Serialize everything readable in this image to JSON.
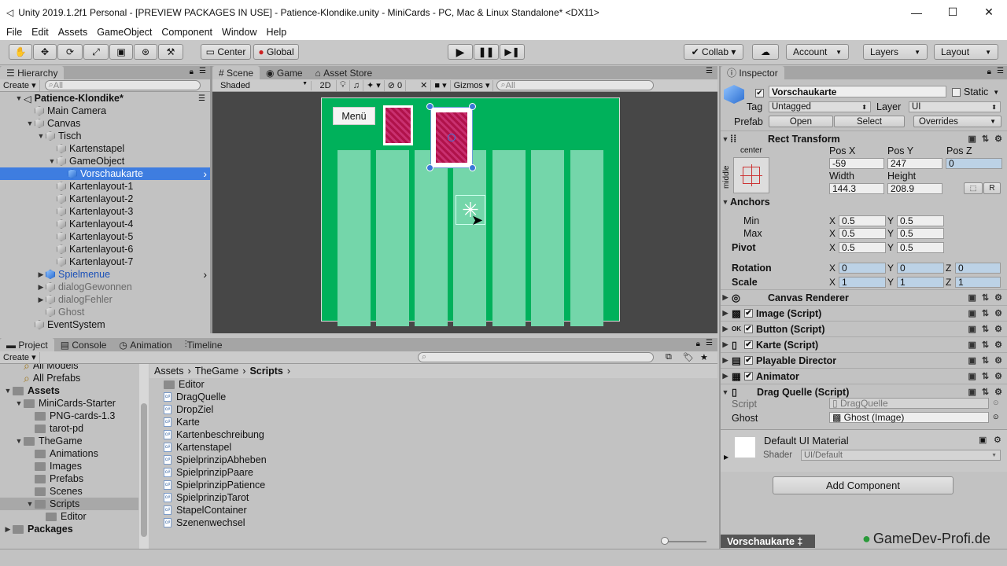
{
  "window": {
    "title": "Unity 2019.1.2f1 Personal - [PREVIEW PACKAGES IN USE] - Patience-Klondike.unity - MiniCards - PC, Mac & Linux Standalone* <DX11>"
  },
  "menu": [
    "File",
    "Edit",
    "Assets",
    "GameObject",
    "Component",
    "Window",
    "Help"
  ],
  "toolbar": {
    "center": "Center",
    "global": "Global",
    "collab": "Collab ▾",
    "account": "Account",
    "layers": "Layers",
    "layout": "Layout"
  },
  "hierarchy": {
    "tab": "Hierarchy",
    "create": "Create ▾",
    "search": "All",
    "items": [
      {
        "label": "Patience-Klondike*",
        "depth": 0,
        "arrow": "▼",
        "icon": "unity-scene-icon"
      },
      {
        "label": "Main Camera",
        "depth": 1,
        "arrow": "",
        "icon": "cube"
      },
      {
        "label": "Canvas",
        "depth": 1,
        "arrow": "▼",
        "icon": "cube"
      },
      {
        "label": "Tisch",
        "depth": 2,
        "arrow": "▼",
        "icon": "cube"
      },
      {
        "label": "Kartenstapel",
        "depth": 3,
        "arrow": "",
        "icon": "cube"
      },
      {
        "label": "GameObject",
        "depth": 3,
        "arrow": "▼",
        "icon": "cube"
      },
      {
        "label": "Vorschaukarte",
        "depth": 4,
        "arrow": "",
        "icon": "cube-blue",
        "selected": true
      },
      {
        "label": "Kartenlayout-1",
        "depth": 3,
        "arrow": "",
        "icon": "cube"
      },
      {
        "label": "Kartenlayout-2",
        "depth": 3,
        "arrow": "",
        "icon": "cube"
      },
      {
        "label": "Kartenlayout-3",
        "depth": 3,
        "arrow": "",
        "icon": "cube"
      },
      {
        "label": "Kartenlayout-4",
        "depth": 3,
        "arrow": "",
        "icon": "cube"
      },
      {
        "label": "Kartenlayout-5",
        "depth": 3,
        "arrow": "",
        "icon": "cube"
      },
      {
        "label": "Kartenlayout-6",
        "depth": 3,
        "arrow": "",
        "icon": "cube"
      },
      {
        "label": "Kartenlayout-7",
        "depth": 3,
        "arrow": "",
        "icon": "cube"
      },
      {
        "label": "Spielmenue",
        "depth": 2,
        "arrow": "▶",
        "icon": "cube-blue",
        "prefab": true
      },
      {
        "label": "dialogGewonnen",
        "depth": 2,
        "arrow": "▶",
        "icon": "cube",
        "dim": true
      },
      {
        "label": "dialogFehler",
        "depth": 2,
        "arrow": "▶",
        "icon": "cube",
        "dim": true
      },
      {
        "label": "Ghost",
        "depth": 2,
        "arrow": "",
        "icon": "cube",
        "dim": true
      },
      {
        "label": "EventSystem",
        "depth": 1,
        "arrow": "",
        "icon": "cube"
      }
    ]
  },
  "scene": {
    "tabs": [
      "Scene",
      "Game",
      "Asset Store"
    ],
    "shaded": "Shaded",
    "twod": "2D",
    "fx_count": "0",
    "gizmos": "Gizmos ▾",
    "search": "All",
    "menu_button": "Menü"
  },
  "project": {
    "tabs": [
      "Project",
      "Console",
      "Animation",
      "Timeline"
    ],
    "create": "Create ▾",
    "tree": [
      {
        "label": "All Models",
        "depth": 1,
        "icon": "search"
      },
      {
        "label": "All Prefabs",
        "depth": 1,
        "icon": "search"
      },
      {
        "label": "Assets",
        "depth": 0,
        "arrow": "▼",
        "bold": true
      },
      {
        "label": "MiniCards-Starter",
        "depth": 1,
        "arrow": "▼"
      },
      {
        "label": "PNG-cards-1.3",
        "depth": 2,
        "arrow": ""
      },
      {
        "label": "tarot-pd",
        "depth": 2,
        "arrow": ""
      },
      {
        "label": "TheGame",
        "depth": 1,
        "arrow": "▼"
      },
      {
        "label": "Animations",
        "depth": 2,
        "arrow": ""
      },
      {
        "label": "Images",
        "depth": 2,
        "arrow": ""
      },
      {
        "label": "Prefabs",
        "depth": 2,
        "arrow": ""
      },
      {
        "label": "Scenes",
        "depth": 2,
        "arrow": ""
      },
      {
        "label": "Scripts",
        "depth": 2,
        "arrow": "▼",
        "selected": true
      },
      {
        "label": "Editor",
        "depth": 3,
        "arrow": ""
      },
      {
        "label": "Packages",
        "depth": 0,
        "arrow": "▶",
        "bold": true
      }
    ],
    "breadcrumb": [
      "Assets",
      "TheGame",
      "Scripts"
    ],
    "files": [
      {
        "label": "Editor",
        "type": "folder"
      },
      {
        "label": "DragQuelle",
        "type": "script"
      },
      {
        "label": "DropZiel",
        "type": "script"
      },
      {
        "label": "Karte",
        "type": "script"
      },
      {
        "label": "Kartenbeschreibung",
        "type": "script"
      },
      {
        "label": "Kartenstapel",
        "type": "script"
      },
      {
        "label": "SpielprinzipAbheben",
        "type": "script"
      },
      {
        "label": "SpielprinzipPaare",
        "type": "script"
      },
      {
        "label": "SpielprinzipPatience",
        "type": "script"
      },
      {
        "label": "SpielprinzipTarot",
        "type": "script"
      },
      {
        "label": "StapelContainer",
        "type": "script"
      },
      {
        "label": "Szenenwechsel",
        "type": "script"
      }
    ]
  },
  "inspector": {
    "tab": "Inspector",
    "name": "Vorschaukarte",
    "static": "Static",
    "tag_label": "Tag",
    "tag": "Untagged",
    "layer_label": "Layer",
    "layer": "UI",
    "prefab_label": "Prefab",
    "open": "Open",
    "select": "Select",
    "overrides": "Overrides",
    "rect": {
      "title": "Rect Transform",
      "anchor_h": "center",
      "anchor_v": "middle",
      "posx_label": "Pos X",
      "posy_label": "Pos Y",
      "posz_label": "Pos Z",
      "posx": "-59",
      "posy": "247",
      "posz": "0",
      "width_label": "Width",
      "height_label": "Height",
      "width": "144.3",
      "height": "208.9",
      "anchors": "Anchors",
      "min": "Min",
      "max": "Max",
      "min_x": "0.5",
      "min_y": "0.5",
      "max_x": "0.5",
      "max_y": "0.5",
      "pivot": "Pivot",
      "pivot_x": "0.5",
      "pivot_y": "0.5",
      "rotation": "Rotation",
      "rot_x": "0",
      "rot_y": "0",
      "rot_z": "0",
      "scale": "Scale",
      "sc_x": "1",
      "sc_y": "1",
      "sc_z": "1",
      "r": "R",
      "x": "X",
      "y": "Y",
      "z": "Z"
    },
    "components": [
      "Canvas Renderer",
      "Image (Script)",
      "Button (Script)",
      "Karte (Script)",
      "Playable Director",
      "Animator",
      "Drag Quelle (Script)"
    ],
    "drag": {
      "script_label": "Script",
      "script": "DragQuelle",
      "ghost_label": "Ghost",
      "ghost": "Ghost (Image)"
    },
    "material": {
      "name": "Default UI Material",
      "shader_label": "Shader",
      "shader": "UI/Default"
    },
    "add_component": "Add Component"
  },
  "status": {
    "selection": "Vorschaukarte ‡",
    "watermark": "GameDev-Profi.de"
  },
  "colors": {
    "selection": "#3e7de0",
    "table_green": "#00b15b",
    "column": "#74d6aa",
    "card_back": "#b0124a"
  }
}
